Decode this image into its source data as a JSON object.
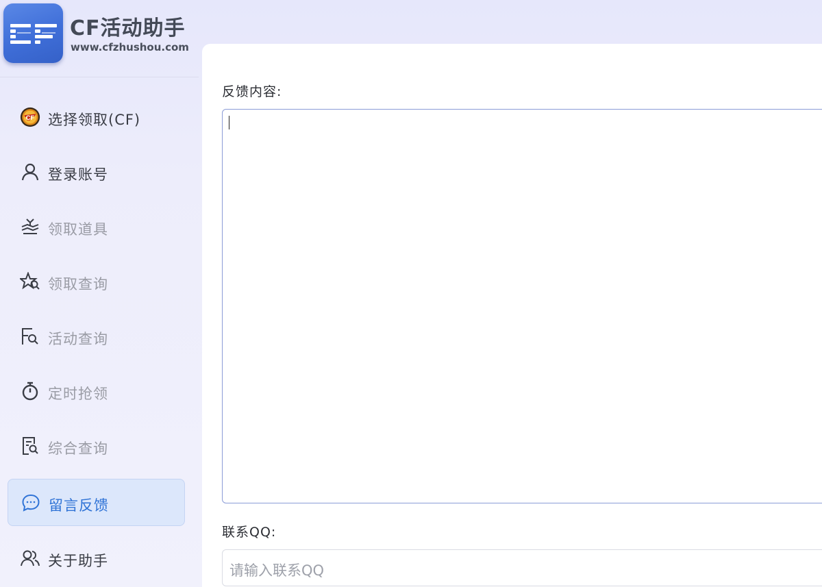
{
  "brand": {
    "title": "CF活动助手",
    "url": "www.cfzhushou.com",
    "logo_text": "CF"
  },
  "sidebar": {
    "items": [
      {
        "label": "选择领取(CF)",
        "icon": "cf-logo-icon",
        "enabled": true,
        "active": false
      },
      {
        "label": "登录账号",
        "icon": "user-icon",
        "enabled": true,
        "active": false
      },
      {
        "label": "领取道具",
        "icon": "gift-receive-icon",
        "enabled": false,
        "active": false
      },
      {
        "label": "领取查询",
        "icon": "star-search-icon",
        "enabled": false,
        "active": false
      },
      {
        "label": "活动查询",
        "icon": "flag-search-icon",
        "enabled": false,
        "active": false
      },
      {
        "label": "定时抢领",
        "icon": "stopwatch-icon",
        "enabled": false,
        "active": false
      },
      {
        "label": "综合查询",
        "icon": "document-search-icon",
        "enabled": false,
        "active": false
      },
      {
        "label": "留言反馈",
        "icon": "chat-bubble-icon",
        "enabled": true,
        "active": true
      },
      {
        "label": "关于助手",
        "icon": "users-icon",
        "enabled": true,
        "active": false
      }
    ]
  },
  "form": {
    "feedback_label": "反馈内容:",
    "feedback_value": "",
    "qq_label": "联系QQ:",
    "qq_placeholder": "请输入联系QQ"
  },
  "colors": {
    "accent": "#2f73d6",
    "active_bg": "#dce7fb",
    "logo_blue": "#3f6ed8"
  }
}
